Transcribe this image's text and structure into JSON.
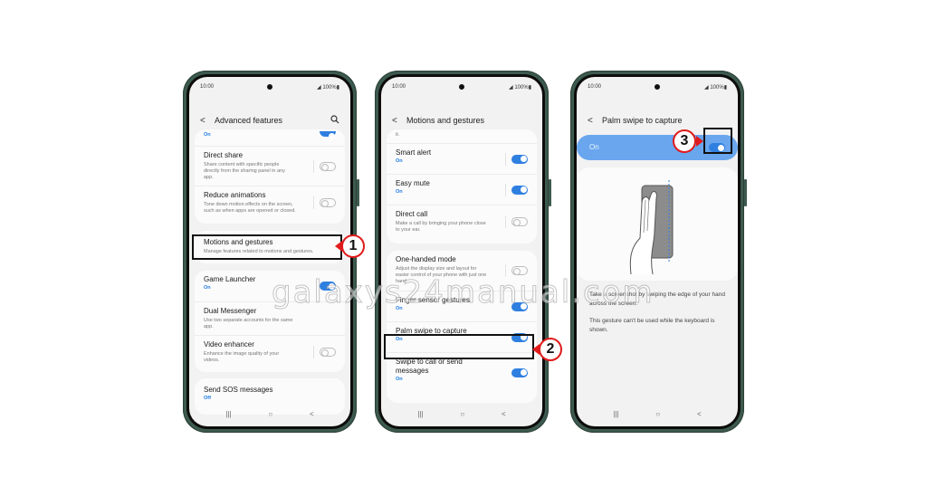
{
  "watermark": "galaxys24manual.com",
  "phones": [
    {
      "status": {
        "time": "10:00",
        "battery": "100%"
      },
      "header": {
        "title": "Advanced features",
        "back_icon": "chevron-left-icon",
        "search_icon": "search-icon"
      },
      "partial_row": {
        "status": "On",
        "toggle": true
      },
      "card1": [
        {
          "label": "Direct share",
          "sub": "Share content with specific people directly from the sharing panel in any app.",
          "toggle": false
        },
        {
          "label": "Reduce animations",
          "sub": "Tone down motion effects on the screen, such as when apps are opened or closed.",
          "toggle": false
        }
      ],
      "motions_row": {
        "label": "Motions and gestures",
        "sub": "Manage features related to motions and gestures."
      },
      "card2": [
        {
          "label": "Game Launcher",
          "status": "On",
          "toggle": true
        },
        {
          "label": "Dual Messenger",
          "sub": "Use two separate accounts for the same app."
        },
        {
          "label": "Video enhancer",
          "sub": "Enhance the image quality of your videos.",
          "toggle": false
        }
      ],
      "card3": [
        {
          "label": "Send SOS messages",
          "status": "Off"
        }
      ],
      "callout": "1"
    },
    {
      "status": {
        "time": "10:00",
        "battery": "100%"
      },
      "header": {
        "title": "Motions and gestures",
        "back_icon": "chevron-left-icon"
      },
      "partial_text": "it.",
      "card1": [
        {
          "label": "Smart alert",
          "status": "On",
          "toggle": true
        },
        {
          "label": "Easy mute",
          "status": "On",
          "toggle": true
        },
        {
          "label": "Direct call",
          "sub": "Make a call by bringing your phone close to your ear.",
          "toggle": false
        }
      ],
      "card2": [
        {
          "label": "One-handed mode",
          "sub": "Adjust the display size and layout for easier control of your phone with just one hand.",
          "toggle": false
        },
        {
          "label": "Finger sensor gestures",
          "status": "On",
          "toggle": true
        },
        {
          "label": "Palm swipe to capture",
          "status": "On",
          "toggle": true
        },
        {
          "label": "Swipe to call or send messages",
          "status": "On",
          "toggle": true
        }
      ],
      "callout": "2"
    },
    {
      "status": {
        "time": "10:00",
        "battery": "100%"
      },
      "header": {
        "title": "Palm swipe to capture",
        "back_icon": "chevron-left-icon"
      },
      "master": {
        "label": "On",
        "toggle": true
      },
      "illustration": "palm-swipe-illustration",
      "desc1": "Take a screenshot by swiping the edge of your hand across the screen.",
      "desc2": "This gesture can't be used while the keyboard is shown.",
      "callout": "3"
    }
  ],
  "nav": {
    "recent": "|||",
    "home": "○",
    "back": "<"
  },
  "colors": {
    "accent": "#2f7fe0",
    "callout_ring": "#e01b1b",
    "master_bar": "#69a6ee",
    "frame": "#3d5a4e"
  }
}
